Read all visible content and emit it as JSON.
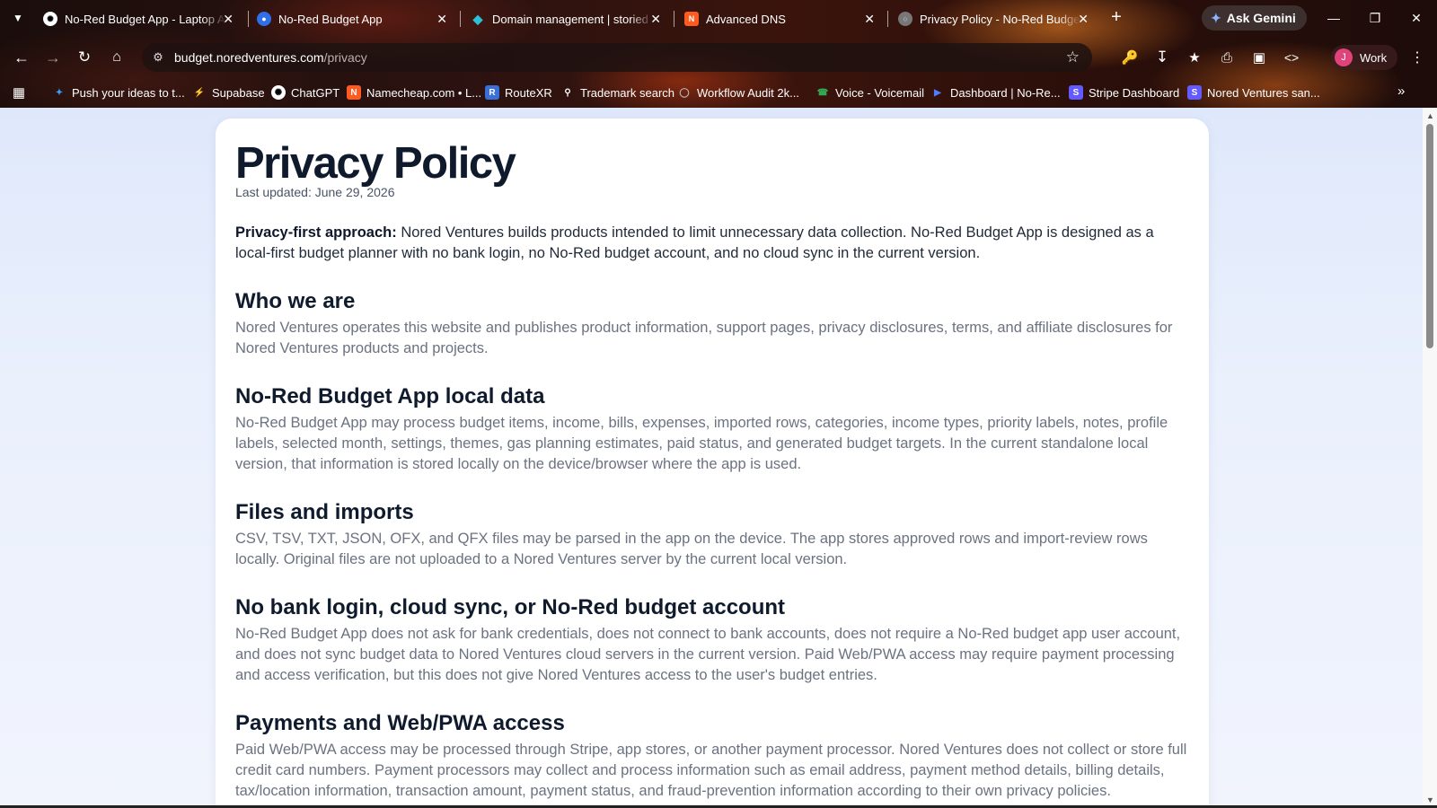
{
  "tabs": [
    {
      "title": "No-Red Budget App - Laptop A",
      "icon": "chatgpt-icon",
      "active": false
    },
    {
      "title": "No-Red Budget App",
      "icon": "app-icon",
      "active": false
    },
    {
      "title": "Domain management | storied",
      "icon": "diamond-icon",
      "active": false
    },
    {
      "title": "Advanced DNS",
      "icon": "namecheap-icon",
      "active": false
    },
    {
      "title": "Privacy Policy - No-Red Budget",
      "icon": "globe-icon",
      "active": true
    }
  ],
  "gemini_label": "Ask Gemini",
  "address": {
    "host": "budget.noredventures.com",
    "path": "/privacy"
  },
  "profile": {
    "initial": "J",
    "label": "Work"
  },
  "bookmarks": [
    {
      "label": "Push your ideas to t...",
      "icon": "sparkle-icon",
      "color": "#34a0ff"
    },
    {
      "label": "Supabase",
      "icon": "bolt-icon",
      "color": "#3ecf8e"
    },
    {
      "label": "ChatGPT",
      "icon": "chatgpt-icon",
      "color": "#ffffff"
    },
    {
      "label": "Namecheap.com • L...",
      "icon": "namecheap-icon",
      "color": "#ff5a1f"
    },
    {
      "label": "RouteXR",
      "icon": "routexr-icon",
      "color": "#3a6fd8"
    },
    {
      "label": "Trademark search",
      "icon": "pin-icon",
      "color": "#ffffff"
    },
    {
      "label": "Workflow Audit 2k...",
      "icon": "globe-icon",
      "color": "#bbbbbb"
    },
    {
      "label": "Voice - Voicemail",
      "icon": "voice-icon",
      "color": "#34a853"
    },
    {
      "label": "Dashboard | No-Re...",
      "icon": "dashboard-icon",
      "color": "#4f7cff"
    },
    {
      "label": "Stripe Dashboard",
      "icon": "stripe-icon",
      "color": "#635bff"
    },
    {
      "label": "Nored Ventures san...",
      "icon": "stripe-icon",
      "color": "#635bff"
    }
  ],
  "page": {
    "title": "Privacy Policy",
    "updated": "Last updated: June 29, 2026",
    "lead_bold": "Privacy-first approach:",
    "lead_text": " Nored Ventures builds products intended to limit unnecessary data collection. No-Red Budget App is designed as a local-first budget planner with no bank login, no No-Red budget account, and no cloud sync in the current version.",
    "sections": [
      {
        "heading": "Who we are",
        "body": "Nored Ventures operates this website and publishes product information, support pages, privacy disclosures, terms, and affiliate disclosures for Nored Ventures products and projects."
      },
      {
        "heading": "No-Red Budget App local data",
        "body": "No-Red Budget App may process budget items, income, bills, expenses, imported rows, categories, income types, priority labels, notes, profile labels, selected month, settings, themes, gas planning estimates, paid status, and generated budget targets. In the current standalone local version, that information is stored locally on the device/browser where the app is used."
      },
      {
        "heading": "Files and imports",
        "body": "CSV, TSV, TXT, JSON, OFX, and QFX files may be parsed in the app on the device. The app stores approved rows and import-review rows locally. Original files are not uploaded to a Nored Ventures server by the current local version."
      },
      {
        "heading": "No bank login, cloud sync, or No-Red budget account",
        "body": "No-Red Budget App does not ask for bank credentials, does not connect to bank accounts, does not require a No-Red budget app user account, and does not sync budget data to Nored Ventures cloud servers in the current version. Paid Web/PWA access may require payment processing and access verification, but this does not give Nored Ventures access to the user's budget entries."
      },
      {
        "heading": "Payments and Web/PWA access",
        "body": "Paid Web/PWA access may be processed through Stripe, app stores, or another payment processor. Nored Ventures does not collect or store full credit card numbers. Payment processors may collect and process information such as email address, payment method details, billing details, tax/location information, transaction amount, payment status, and fraud-prevention information according to their own privacy policies."
      }
    ]
  }
}
